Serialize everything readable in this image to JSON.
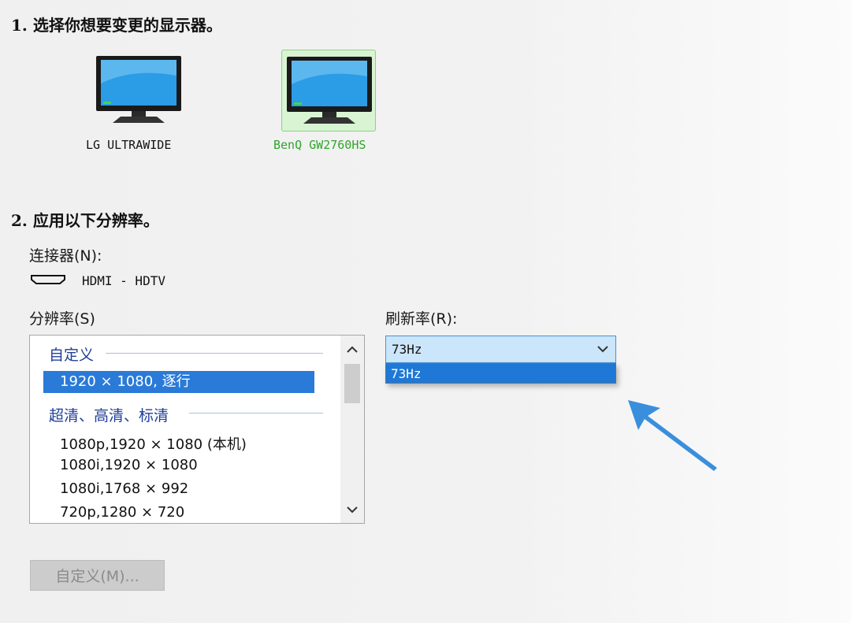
{
  "section1": {
    "title": "1. 选择你想要变更的显示器。"
  },
  "monitors": [
    {
      "name": "LG ULTRAWIDE",
      "selected": false
    },
    {
      "name": "BenQ GW2760HS",
      "selected": true
    }
  ],
  "section2": {
    "title": "2. 应用以下分辨率。"
  },
  "connector": {
    "label": "连接器(N):",
    "value": "HDMI - HDTV"
  },
  "resolution": {
    "label": "分辨率(S)",
    "groups": [
      {
        "title": "自定义",
        "items": [
          "1920 × 1080, 逐行"
        ]
      },
      {
        "title": "超清、高清、标清",
        "items": [
          "1080p,1920 × 1080 (本机)",
          "1080i,1920 × 1080",
          "1080i,1768 × 992",
          "720p,1280 × 720"
        ]
      }
    ],
    "selected_item": "1920 × 1080, 逐行"
  },
  "refresh": {
    "label": "刷新率(R):",
    "value": "73Hz",
    "options": [
      "73Hz"
    ]
  },
  "custom_button": {
    "label": "自定义(M)..."
  },
  "colors": {
    "accent": "#2a7ad8",
    "selected_monitor_text": "#2fa52a",
    "arrow": "#3a8fdc"
  }
}
